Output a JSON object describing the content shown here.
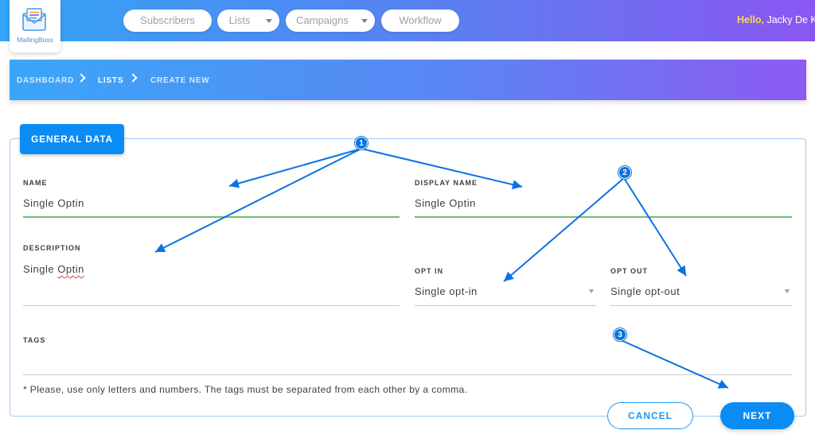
{
  "app": {
    "logo_text": "MailingBoss"
  },
  "nav": {
    "items": [
      {
        "label": "Subscribers",
        "has_dropdown": false
      },
      {
        "label": "Lists",
        "has_dropdown": true
      },
      {
        "label": "Campaigns",
        "has_dropdown": true
      },
      {
        "label": "Workflow",
        "has_dropdown": false
      }
    ]
  },
  "user": {
    "hello": "Hello,",
    "name": "Jacky De K"
  },
  "breadcrumb": {
    "items": [
      "DASHBOARD",
      "LISTS",
      "CREATE NEW"
    ]
  },
  "form": {
    "tab_label": "GENERAL DATA",
    "name": {
      "label": "NAME",
      "value": "Single Optin"
    },
    "display_name": {
      "label": "DISPLAY NAME",
      "value": "Single Optin"
    },
    "description": {
      "label": "DESCRIPTION",
      "value_a": "Single ",
      "value_b": "Optin"
    },
    "opt_in": {
      "label": "OPT IN",
      "value": "Single opt-in"
    },
    "opt_out": {
      "label": "OPT OUT",
      "value": "Single opt-out"
    },
    "tags": {
      "label": "TAGS",
      "value": ""
    },
    "note": "* Please, use only letters and numbers. The tags must be separated from each other by a comma."
  },
  "actions": {
    "cancel_label": "CANCEL",
    "next_label": "NEXT"
  },
  "annotations": {
    "badges": [
      "1",
      "2",
      "3"
    ],
    "color": "#0b72e0"
  },
  "colors": {
    "accent": "#0b8cf4",
    "field_active_underline": "#6cc070",
    "greeting_highlight": "#ffd84a"
  }
}
